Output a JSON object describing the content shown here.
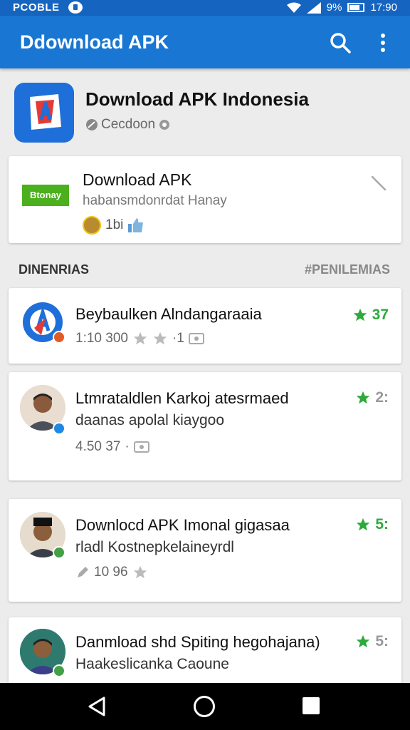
{
  "status_bar": {
    "carrier": "PCOBLE",
    "battery": "9%",
    "time": "17:90"
  },
  "app_bar": {
    "title": "Ddownload APK"
  },
  "app_header": {
    "title": "Download APK Indonesia",
    "developer": "Cecdoon"
  },
  "featured": {
    "badge": "Btonay",
    "title": "Download APK",
    "subtitle": "habansmdonrdat Hanay",
    "count": "1bi"
  },
  "section": {
    "left": "DINENRIAS",
    "right": "PENILEMIAS"
  },
  "items": [
    {
      "line1": "Beybaulken Alndangaraaia",
      "line2": "",
      "meta": "1:10 300",
      "meta_suffix": "·1",
      "rating": "37"
    },
    {
      "line1": "Ltmrataldlen Karkoj atesrmaed",
      "line2": "daanas apolal kiaygoo",
      "meta": "4.50 37",
      "meta_suffix": "·",
      "rating": "2:"
    },
    {
      "line1": "Downlocd APK Imonal gigasaa",
      "line2": "rladl Kostnepkelaineyrdl",
      "meta": "10 96",
      "meta_suffix": "",
      "rating": "5:"
    },
    {
      "line1": "Danmload shd Spiting hegohajana)",
      "line2": "Haakeslicanka Caoune",
      "meta": "",
      "meta_suffix": "",
      "rating": "5:"
    }
  ],
  "colors": {
    "primary": "#1976d2",
    "accent_green": "#2eaa3c",
    "badge_green": "#4caf1e"
  },
  "icons": [
    "wifi-icon",
    "signal-icon",
    "battery-icon",
    "search-icon",
    "more-vert-icon",
    "star-icon",
    "back-icon",
    "home-icon",
    "recents-icon"
  ]
}
